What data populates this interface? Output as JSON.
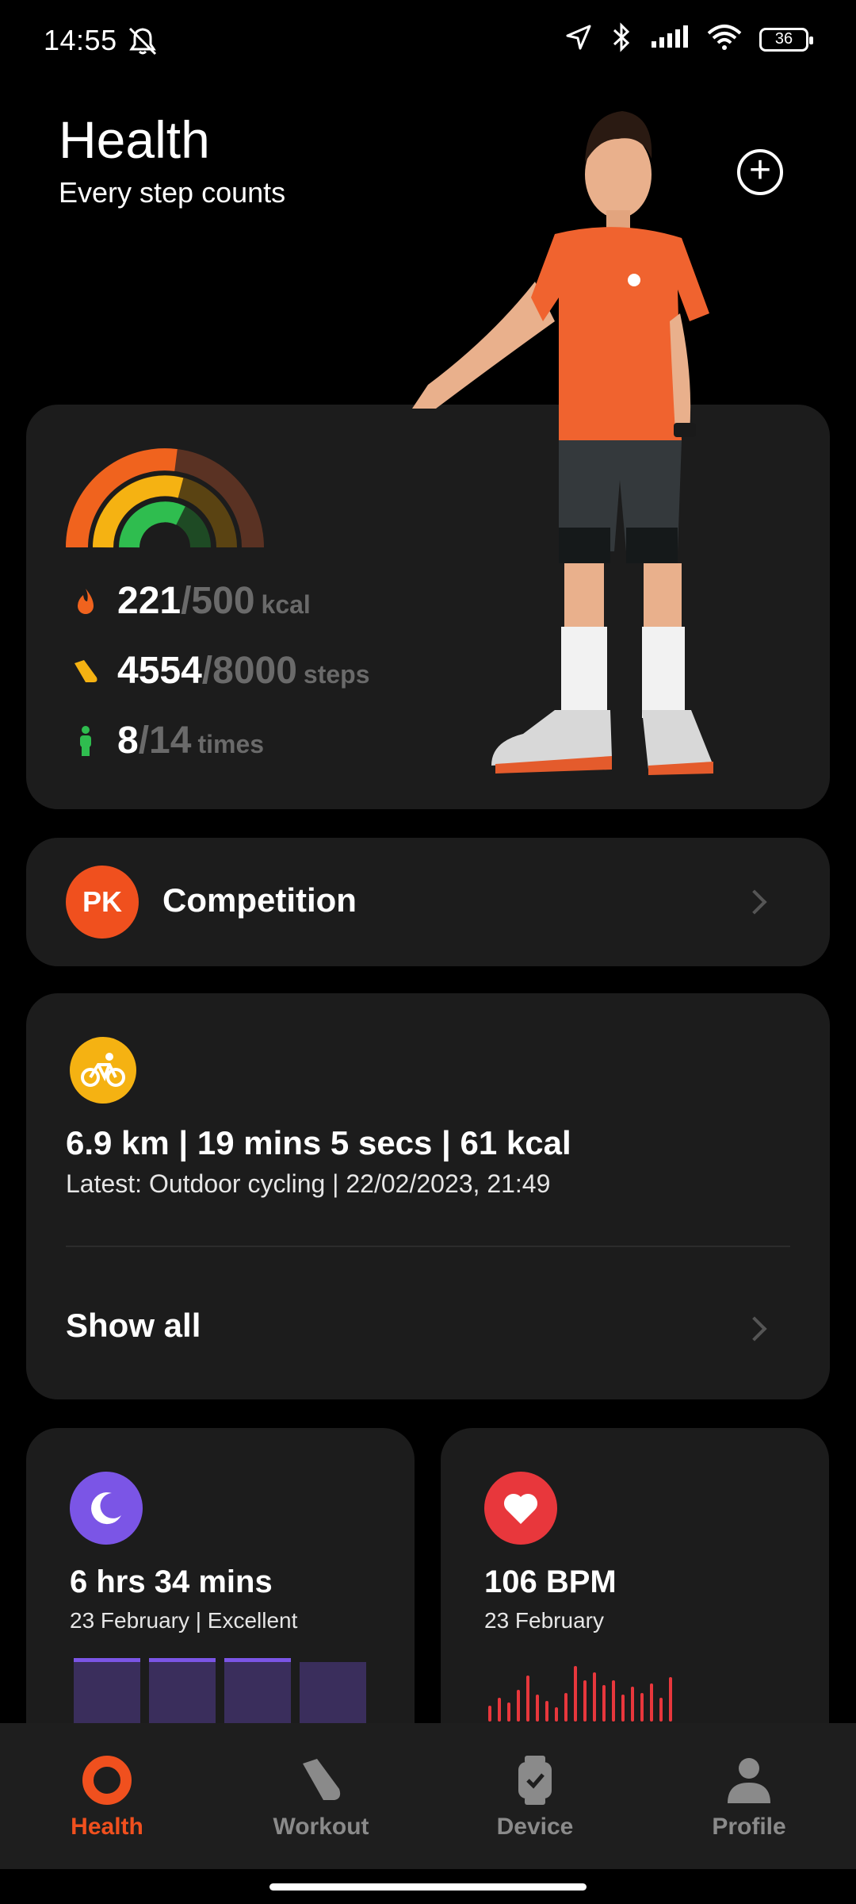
{
  "status_bar": {
    "time": "14:55",
    "battery": "36"
  },
  "header": {
    "title": "Health",
    "subtitle": "Every step counts"
  },
  "activity": {
    "calories": {
      "current": "221",
      "goal": "/500",
      "unit": "kcal"
    },
    "steps": {
      "current": "4554",
      "goal": "/8000",
      "unit": "steps"
    },
    "standing": {
      "current": "8",
      "goal": "/14",
      "unit": "times"
    }
  },
  "competition": {
    "badge": "PK",
    "label": "Competition"
  },
  "workout": {
    "summary": "6.9 km | 19 mins 5 secs | 61 kcal",
    "latest": "Latest: Outdoor cycling | 22/02/2023, 21:49",
    "show_all": "Show all"
  },
  "sleep": {
    "duration": "6 hrs 34 mins",
    "detail": "23 February | Excellent"
  },
  "heart_rate": {
    "value": "106 BPM",
    "date": "23 February"
  },
  "nav": [
    {
      "label": "Health"
    },
    {
      "label": "Workout"
    },
    {
      "label": "Device"
    },
    {
      "label": "Profile"
    }
  ],
  "colors": {
    "accent": "#f0501e",
    "card": "#1c1c1c",
    "cycling": "#f5b212",
    "sleep": "#7b55e6",
    "heart": "#e8373c"
  }
}
